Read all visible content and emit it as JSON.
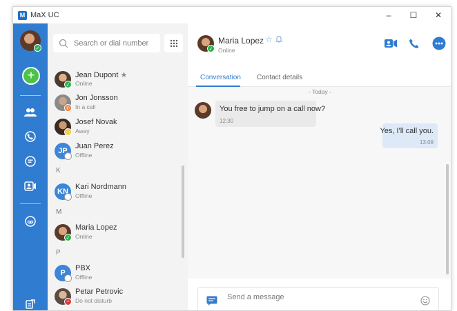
{
  "app": {
    "title": "MaX UC",
    "logo": "M"
  },
  "window": {
    "minimize": "–",
    "maximize": "☐",
    "close": "✕"
  },
  "colors": {
    "accent": "#2f7cd1",
    "online": "#2bb24c",
    "in_call": "#e8742a",
    "away": "#f1c21b",
    "dnd": "#d93b3b"
  },
  "rail": {
    "icons": [
      "contacts-icon",
      "phone-icon",
      "chat-icon",
      "meeting-icon",
      "voicemail-icon",
      "presence-bottom-icon"
    ]
  },
  "search": {
    "placeholder": "Search or dial number"
  },
  "contacts": {
    "sections": {
      "k": "K",
      "m": "M",
      "p": "P"
    },
    "items": [
      {
        "name": "Jean Dupont",
        "status": "Online",
        "favorite": "★"
      },
      {
        "name": "Jon Jonsson",
        "status": "In a call"
      },
      {
        "name": "Josef Novak",
        "status": "Away"
      },
      {
        "name": "Juan Perez",
        "status": "Offline",
        "initials": "JP"
      },
      {
        "name": "Kari Nordmann",
        "status": "Offline",
        "initials": "KN"
      },
      {
        "name": "Maria Lopez",
        "status": "Online"
      },
      {
        "name": "PBX",
        "status": "Offline",
        "initials": "P"
      },
      {
        "name": "Petar Petrovic",
        "status": "Do not disturb"
      }
    ]
  },
  "chat": {
    "contact_name": "Maria Lopez",
    "contact_status": "Online",
    "star": "☆",
    "tabs": [
      "Conversation",
      "Contact details"
    ],
    "day_separator": "- Today -",
    "messages": [
      {
        "text": "You free to jump on a call now?",
        "time": "12:30",
        "direction": "in"
      },
      {
        "text": "Yes, I'll call you.",
        "time": "13:09",
        "direction": "out"
      }
    ],
    "composer_placeholder": "Send a message"
  }
}
